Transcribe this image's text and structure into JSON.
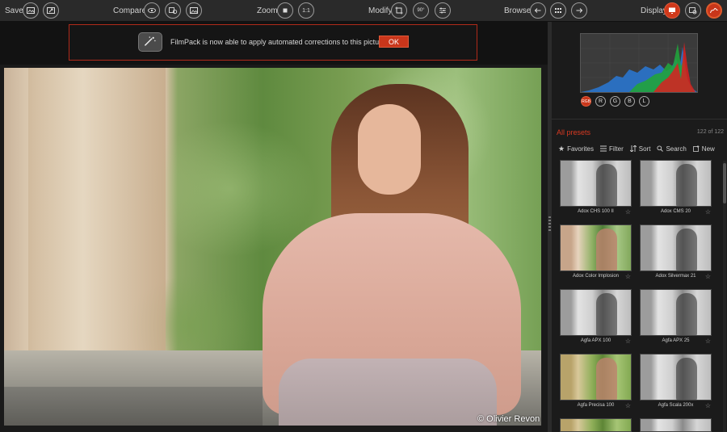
{
  "toolbar": {
    "save_label": "Save",
    "compare_label": "Compare",
    "zoom_label": "Zoom",
    "zoom_ratio": "1:1",
    "modify_label": "Modify",
    "rotate_label": "90°",
    "browse_label": "Browse",
    "display_label": "Display"
  },
  "notification": {
    "message": "FilmPack is now able to apply automated corrections to this picture.",
    "ok_label": "OK"
  },
  "photo": {
    "credit": "© Olivier Revon"
  },
  "histogram": {
    "channels": [
      "RGB",
      "R",
      "G",
      "B",
      "L"
    ],
    "active_channel": "RGB"
  },
  "presets": {
    "title": "All presets",
    "count": "122 of 122",
    "toolbar": {
      "favorites": "Favorites",
      "filter": "Filter",
      "sort": "Sort",
      "search": "Search",
      "new": "New"
    },
    "items": [
      {
        "name": "Adox CHS 100 II",
        "style": "bw"
      },
      {
        "name": "Adox CMS 20",
        "style": "bw"
      },
      {
        "name": "Adox Color Implosion",
        "style": "color1"
      },
      {
        "name": "Adox Silvermax 21",
        "style": "bw"
      },
      {
        "name": "Agfa APX 100",
        "style": "bw"
      },
      {
        "name": "Agfa APX 25",
        "style": "bw"
      },
      {
        "name": "Agfa Precisa 100",
        "style": "color2"
      },
      {
        "name": "Agfa Scala 200x",
        "style": "bw"
      }
    ]
  },
  "colors": {
    "accent": "#c9361b",
    "panel_bg": "#1b1b1b",
    "toolbar_bg": "#2a2a2a"
  }
}
